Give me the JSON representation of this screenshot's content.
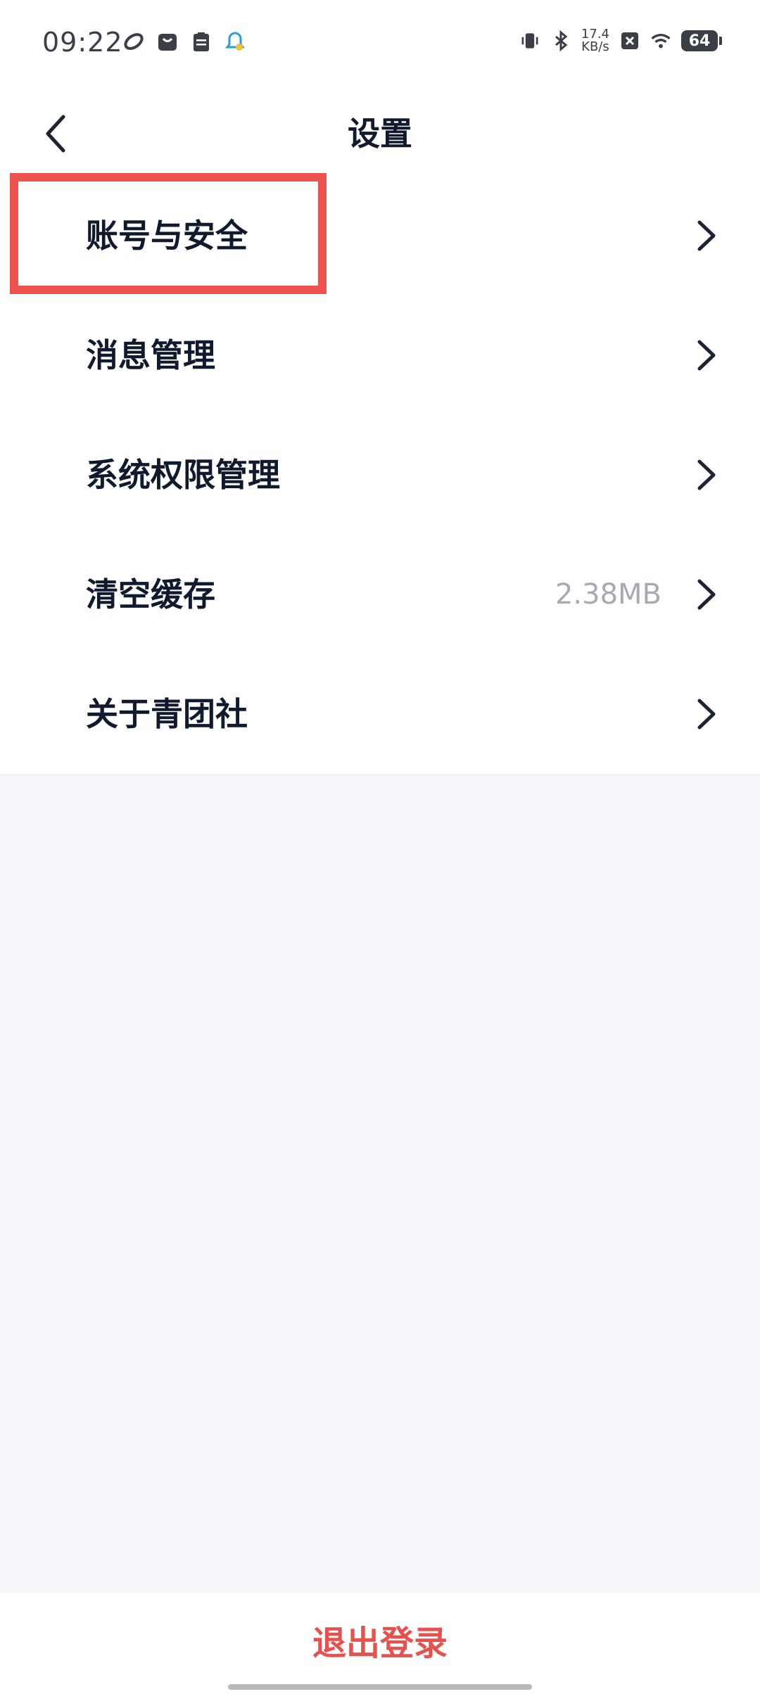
{
  "status_bar": {
    "time": "09:22",
    "net_speed_value": "17.4",
    "net_speed_unit": "KB/s",
    "battery": "64",
    "left_icons": [
      "swirl-icon",
      "shopping-bag-icon",
      "clipboard-icon",
      "bell-icon"
    ],
    "right_icons": [
      "vibrate-icon",
      "bluetooth-icon",
      "close-box-icon",
      "wifi-icon",
      "battery-icon"
    ]
  },
  "header": {
    "title": "设置",
    "back_icon": "chevron-left-icon"
  },
  "settings": [
    {
      "label": "账号与安全",
      "value": ""
    },
    {
      "label": "消息管理",
      "value": ""
    },
    {
      "label": "系统权限管理",
      "value": ""
    },
    {
      "label": "清空缓存",
      "value": "2.38MB"
    },
    {
      "label": "关于青团社",
      "value": ""
    }
  ],
  "footer": {
    "logout_label": "退出登录"
  },
  "colors": {
    "accent_red": "#e8504d",
    "highlight_border": "#ee5350",
    "text_dark": "#0f1a2e",
    "text_muted": "#a6aab3",
    "page_background": "#f4f6fa"
  }
}
